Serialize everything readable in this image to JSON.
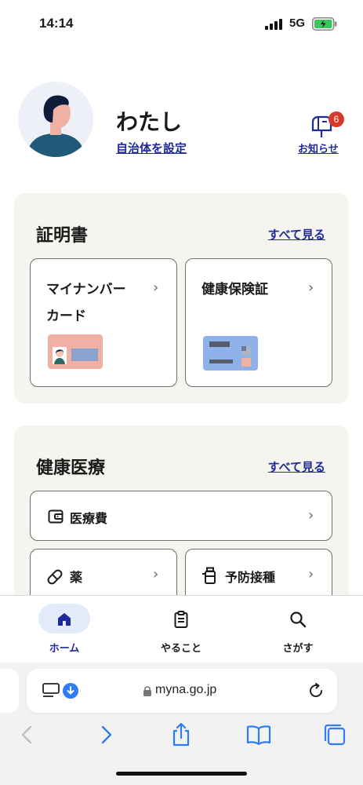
{
  "status_bar": {
    "time": "14:14",
    "network": "5G"
  },
  "profile": {
    "name": "わたし",
    "set_municipality": "自治体を設定",
    "notices_label": "お知らせ",
    "notices_count": "6"
  },
  "certificates": {
    "title": "証明書",
    "see_all": "すべて見る",
    "cards": [
      {
        "line1": "マイナンバー",
        "line2": "カード"
      },
      {
        "line1": "健康保険証"
      }
    ]
  },
  "health": {
    "title": "健康医療",
    "see_all": "すべて見る",
    "items": [
      {
        "label": "医療費",
        "icon": "wallet-icon"
      },
      {
        "label": "薬",
        "icon": "pill-icon"
      },
      {
        "label": "予防接種",
        "icon": "vaccine-icon"
      }
    ]
  },
  "tabs": [
    {
      "label": "ホーム",
      "icon": "home-icon",
      "active": true
    },
    {
      "label": "やること",
      "icon": "clipboard-icon",
      "active": false
    },
    {
      "label": "さがす",
      "icon": "search-icon",
      "active": false
    }
  ],
  "browser": {
    "url": "myna.go.jp"
  },
  "colors": {
    "accent": "#1f2a9a",
    "badge": "#d4392b",
    "section_bg": "#f6f4ef",
    "active_tab_bg": "#e3ebfb"
  }
}
